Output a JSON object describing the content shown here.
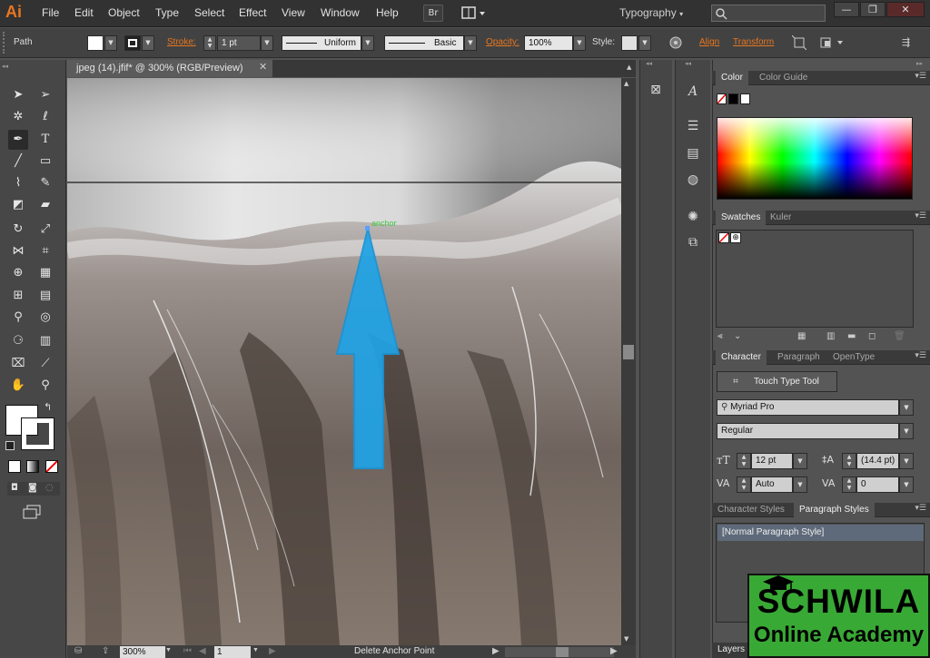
{
  "app": {
    "logo": "Ai",
    "bridge_label": "Br"
  },
  "menu": [
    "File",
    "Edit",
    "Object",
    "Type",
    "Select",
    "Effect",
    "View",
    "Window",
    "Help"
  ],
  "workspace": {
    "name": "Typography"
  },
  "search": {
    "placeholder": ""
  },
  "window_controls": {
    "minimize": "—",
    "restore": "❐",
    "close": "✕"
  },
  "control_bar": {
    "selection_type": "Path",
    "stroke_label": "Stroke:",
    "stroke_weight": "1 pt",
    "profile": "Uniform",
    "brush": "Basic",
    "opacity_label": "Opacity:",
    "opacity_value": "100%",
    "style_label": "Style:",
    "align_label": "Align",
    "transform_label": "Transform"
  },
  "document": {
    "tab_title": "jpeg (14).jfif* @ 300% (RGB/Preview)",
    "close": "✕",
    "anchor_label": "anchor"
  },
  "status": {
    "zoom": "300%",
    "page": "1",
    "message": "Delete Anchor Point"
  },
  "panels": {
    "color_tabs": [
      "Color",
      "Color Guide"
    ],
    "swatches_tabs": [
      "Swatches",
      "Kuler"
    ],
    "character_tabs": [
      "Character",
      "Paragraph",
      "OpenType"
    ],
    "touch_type_label": "Touch Type Tool",
    "font_family": "Myriad Pro",
    "font_style": "Regular",
    "font_size": "12 pt",
    "leading": "(14.4 pt)",
    "kerning": "Auto",
    "tracking": "0",
    "styles_tabs": [
      "Character Styles",
      "Paragraph Styles"
    ],
    "paragraph_style": "[Normal Paragraph Style]",
    "layers_tab": "Layers"
  },
  "watermark": {
    "line1": "SCHWILA",
    "line2": "Online Academy"
  },
  "colors": {
    "accent": "#e8761f",
    "arrow": "#1fa3e6",
    "anchor_label": "#3ec83e",
    "watermark_green": "#39a935"
  }
}
